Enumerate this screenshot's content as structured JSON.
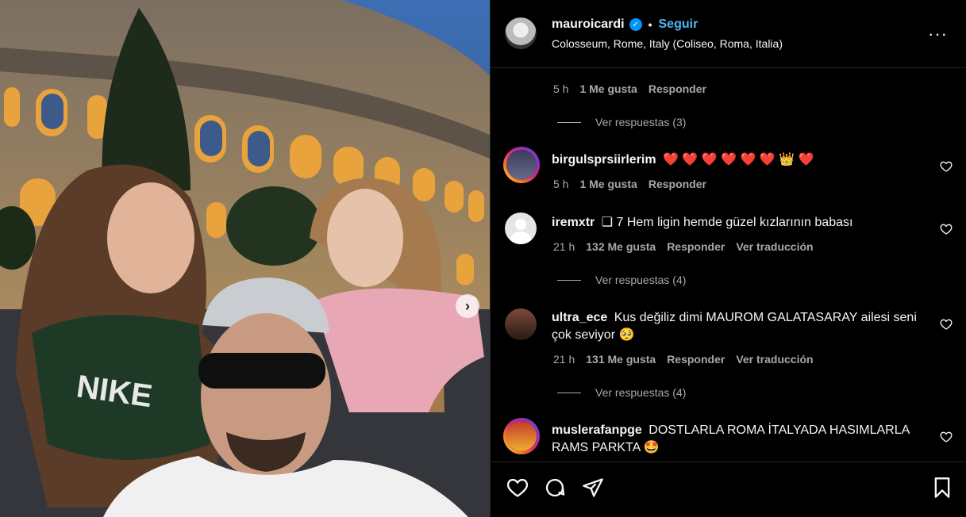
{
  "post": {
    "username": "mauroicardi",
    "follow_label": "Seguir",
    "separator": "•",
    "location": "Colosseum, Rome, Italy (Coliseo, Roma, Italia)",
    "verified_glyph": "✓",
    "more_glyph": "···",
    "carousel_next_glyph": "›"
  },
  "top_meta": {
    "time": "5 h",
    "likes": "1 Me gusta",
    "reply": "Responder"
  },
  "comments": [
    {
      "username": "birgulsprsiirlerim",
      "text": "❤️ ❤️ ❤️ ❤️ ❤️ ❤️ 👑 ❤️",
      "time": "5 h",
      "likes": "1 Me gusta",
      "reply": "Responder",
      "translate": "",
      "view_replies": ""
    },
    {
      "username": "iremxtr",
      "text": "❏ 7 Hem ligin hemde güzel kızlarının babası",
      "time": "21 h",
      "likes": "132 Me gusta",
      "reply": "Responder",
      "translate": "Ver traducción",
      "view_replies": "Ver respuestas (4)"
    },
    {
      "username": "ultra_ece",
      "text": "Kus değiliz dimi MAUROM GALATASARAY ailesi seni çok seviyor 🥺",
      "time": "21 h",
      "likes": "131 Me gusta",
      "reply": "Responder",
      "translate": "Ver traducción",
      "view_replies": "Ver respuestas (4)"
    },
    {
      "username": "muslerafanpge",
      "text": "DOSTLARLA ROMA İTALYADA HASIMLARLA RAMS PARKTA 🤩",
      "time": "",
      "likes": "",
      "reply": "",
      "translate": "",
      "view_replies": ""
    }
  ],
  "first_view_replies": "Ver respuestas (3)",
  "icons": [
    "heart-icon",
    "comment-icon",
    "share-icon",
    "save-icon",
    "verified-icon",
    "more-icon"
  ]
}
